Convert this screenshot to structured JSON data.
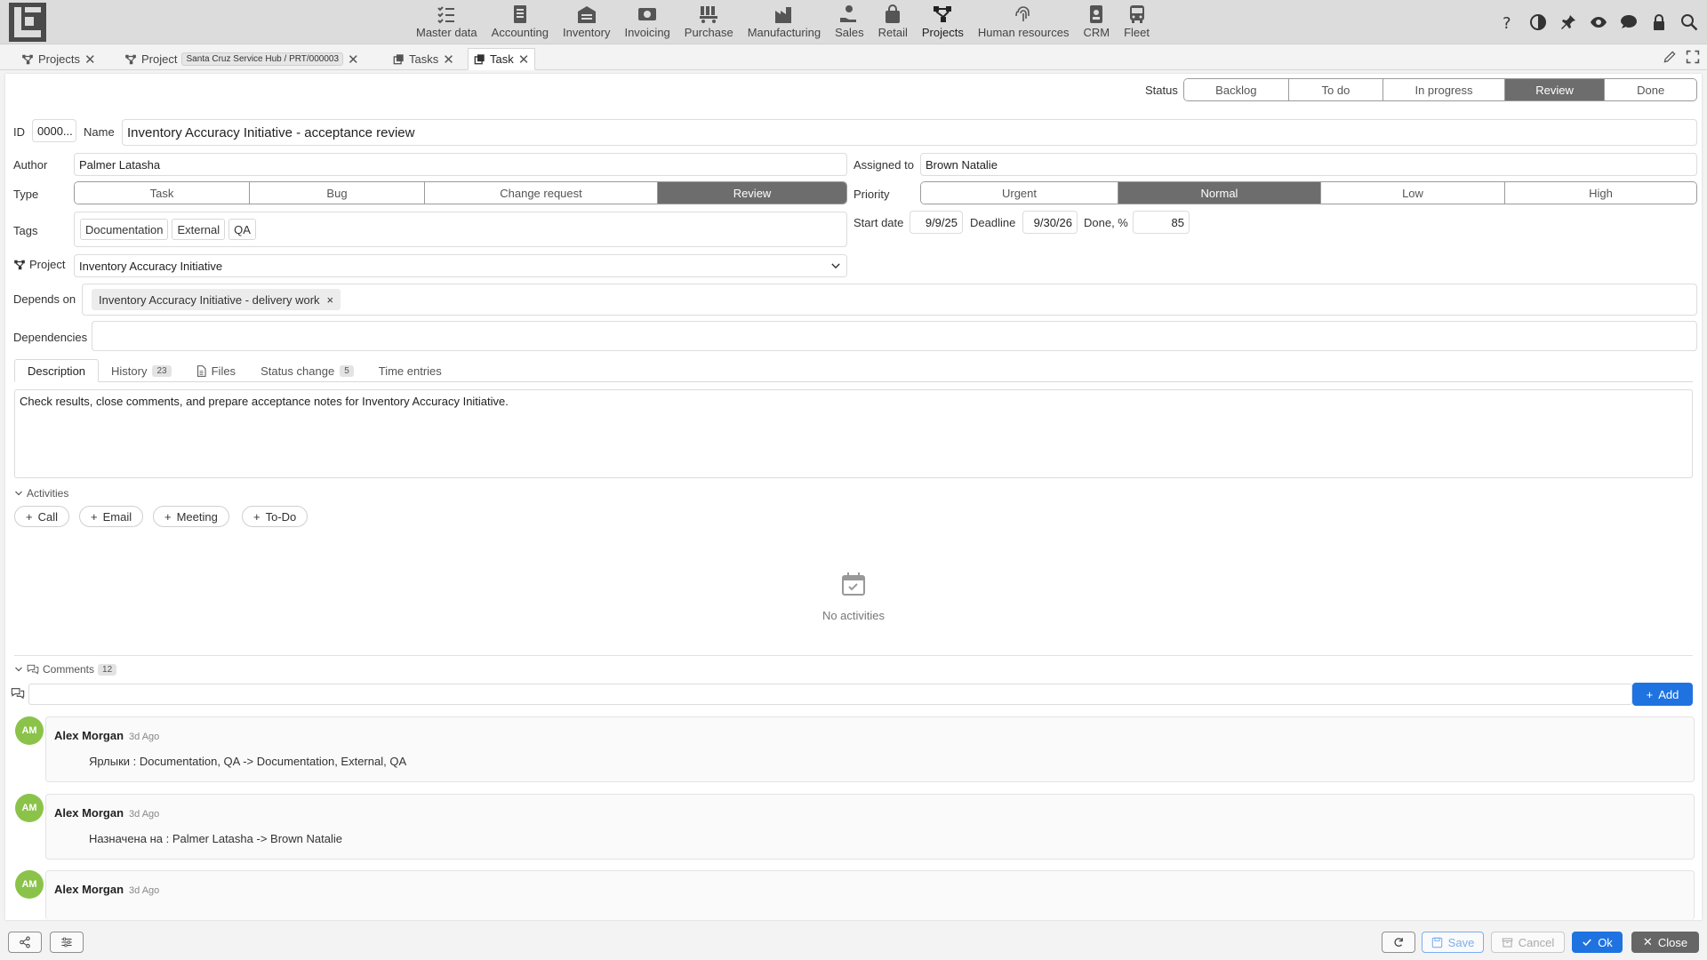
{
  "nav": {
    "modules": [
      {
        "label": "Master data",
        "icon": "list-check-icon"
      },
      {
        "label": "Accounting",
        "icon": "ledger-icon"
      },
      {
        "label": "Inventory",
        "icon": "warehouse-icon"
      },
      {
        "label": "Invoicing",
        "icon": "cash-icon"
      },
      {
        "label": "Purchase",
        "icon": "cart-icon"
      },
      {
        "label": "Manufacturing",
        "icon": "factory-icon"
      },
      {
        "label": "Sales",
        "icon": "hand-coin-icon"
      },
      {
        "label": "Retail",
        "icon": "bag-icon"
      },
      {
        "label": "Projects",
        "icon": "project-tree-icon"
      },
      {
        "label": "Human resources",
        "icon": "fingerprint-icon"
      },
      {
        "label": "CRM",
        "icon": "badge-icon"
      },
      {
        "label": "Fleet",
        "icon": "bus-icon"
      }
    ]
  },
  "tabs": {
    "t1": "Projects",
    "t2": "Project",
    "t2_chip": "Santa Cruz Service Hub / PRT/000003",
    "t3": "Tasks",
    "t4": "Task"
  },
  "status": {
    "label": "Status",
    "options": [
      "Backlog",
      "To do",
      "In progress",
      "Review",
      "Done"
    ],
    "selected": "Review"
  },
  "form": {
    "id_label": "ID",
    "id_value": "0000...",
    "name_label": "Name",
    "name_value": "Inventory Accuracy Initiative - acceptance review",
    "author_label": "Author",
    "author_value": "Palmer Latasha",
    "assigned_label": "Assigned to",
    "assigned_value": "Brown Natalie",
    "type_label": "Type",
    "type_options": [
      "Task",
      "Bug",
      "Change request",
      "Review"
    ],
    "type_selected": "Review",
    "priority_label": "Priority",
    "priority_options": [
      "Urgent",
      "Normal",
      "Low",
      "High"
    ],
    "priority_selected": "Normal",
    "tags_label": "Tags",
    "tags": [
      "Documentation",
      "External",
      "QA"
    ],
    "start_label": "Start date",
    "start_value": "9/9/25",
    "deadline_label": "Deadline",
    "deadline_value": "9/30/26",
    "done_label": "Done, %",
    "done_value": "85",
    "project_label": "Project",
    "project_value": "Inventory Accuracy Initiative",
    "depends_label": "Depends on",
    "depends_value": "Inventory Accuracy Initiative - delivery work",
    "dependencies_label": "Dependencies"
  },
  "subtabs": {
    "description": "Description",
    "history": "History",
    "history_count": "23",
    "files": "Files",
    "status_change": "Status change",
    "status_change_count": "5",
    "time_entries": "Time entries"
  },
  "description_text": "Check results, close comments, and prepare acceptance notes for Inventory Accuracy Initiative.",
  "activities": {
    "header": "Activities",
    "buttons": [
      "Call",
      "Email",
      "Meeting",
      "To-Do"
    ],
    "empty": "No activities"
  },
  "comments": {
    "header": "Comments",
    "count": "12",
    "add_label": "Add",
    "items": [
      {
        "initials": "AM",
        "author": "Alex Morgan",
        "ago": "3d Ago",
        "text": "Ярлыки : Documentation, QA -> Documentation, External, QA"
      },
      {
        "initials": "AM",
        "author": "Alex Morgan",
        "ago": "3d Ago",
        "text": "Назначена на : Palmer Latasha -> Brown Natalie"
      },
      {
        "initials": "AM",
        "author": "Alex Morgan",
        "ago": "3d Ago",
        "text": ""
      }
    ]
  },
  "footer": {
    "save": "Save",
    "cancel": "Cancel",
    "ok": "Ok",
    "close": "Close"
  },
  "colors": {
    "accent": "#1f73e0",
    "selected_segment": "#6d6d6d",
    "avatar": "#8bc34a"
  }
}
